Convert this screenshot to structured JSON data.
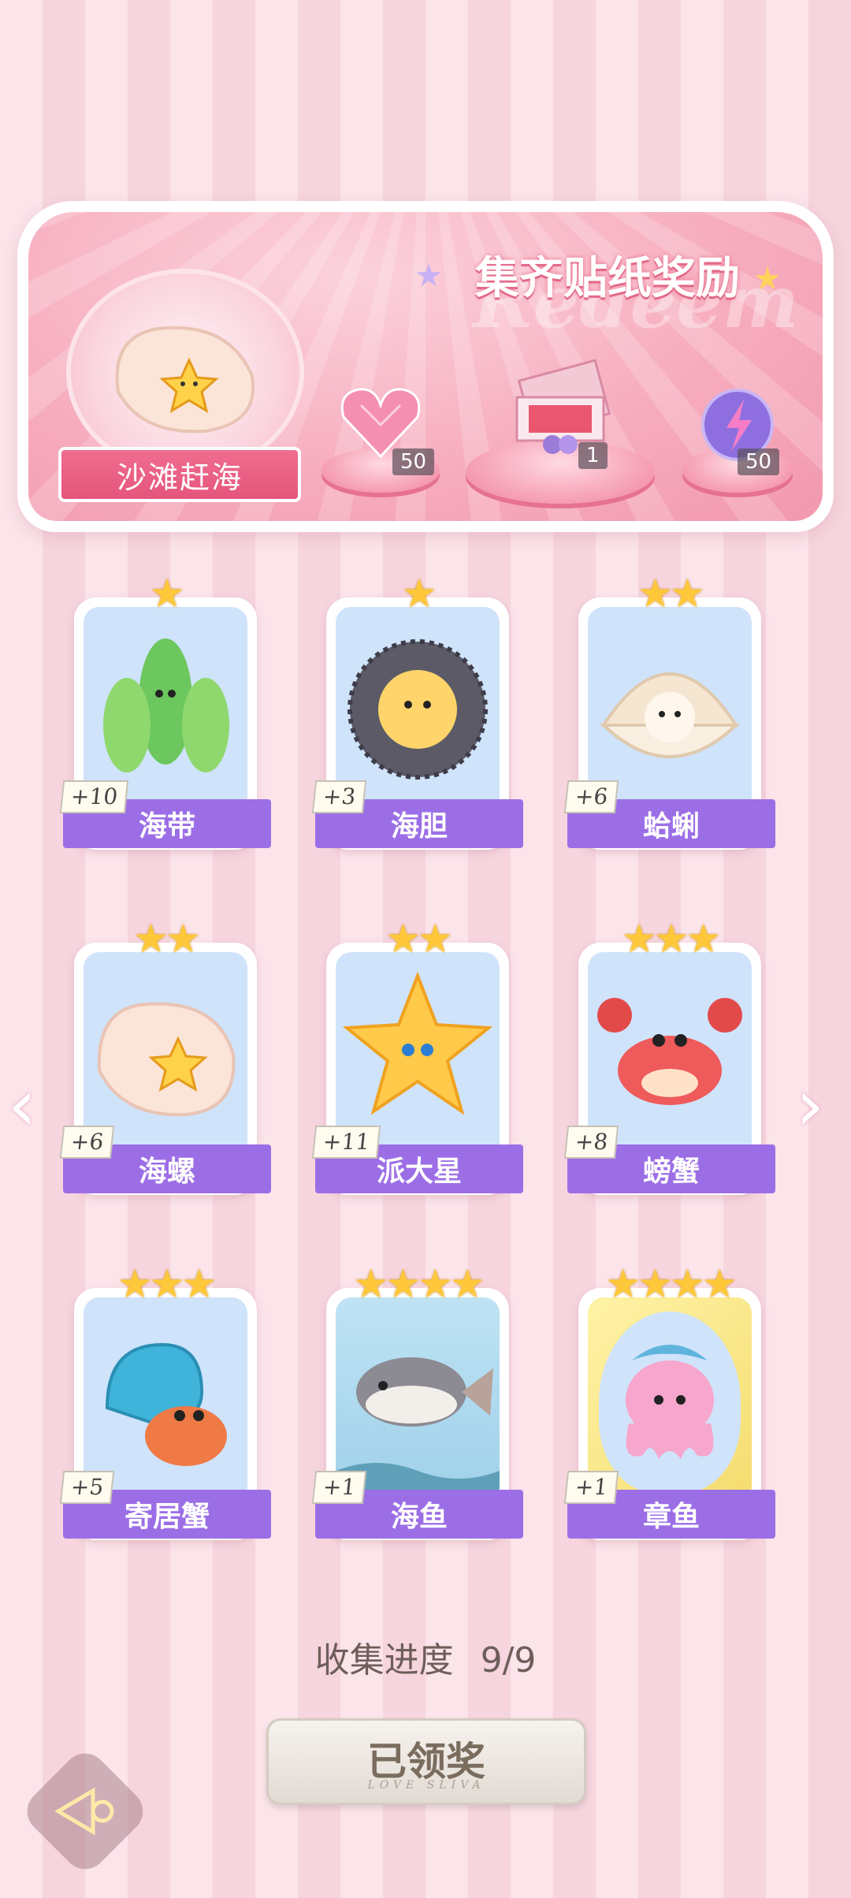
{
  "banner": {
    "title": "集齐贴纸奖励",
    "watermark": "Redeem",
    "set_name": "沙滩赶海",
    "rewards": [
      {
        "icon": "pink-diamond-heart-icon",
        "count": "50"
      },
      {
        "icon": "gift-box-icon",
        "count": "1"
      },
      {
        "icon": "energy-orb-icon",
        "count": "50"
      }
    ]
  },
  "cards": [
    {
      "name": "海带",
      "count": "+10",
      "stars": "★",
      "icon": "kelp-icon"
    },
    {
      "name": "海胆",
      "count": "+3",
      "stars": "★",
      "icon": "sea-urchin-icon"
    },
    {
      "name": "蛤蜊",
      "count": "+6",
      "stars": "★★",
      "icon": "clam-icon"
    },
    {
      "name": "海螺",
      "count": "+6",
      "stars": "★★",
      "icon": "conch-icon"
    },
    {
      "name": "派大星",
      "count": "+11",
      "stars": "★★",
      "icon": "starfish-icon"
    },
    {
      "name": "螃蟹",
      "count": "+8",
      "stars": "★★★",
      "icon": "crab-icon"
    },
    {
      "name": "寄居蟹",
      "count": "+5",
      "stars": "★★★",
      "icon": "hermit-crab-icon"
    },
    {
      "name": "海鱼",
      "count": "+1",
      "stars": "★★★★",
      "icon": "fish-icon"
    },
    {
      "name": "章鱼",
      "count": "+1",
      "stars": "★★★★",
      "icon": "octopus-icon"
    }
  ],
  "nav": {
    "prev": "‹",
    "next": "›"
  },
  "progress": {
    "label": "收集进度",
    "value": "9/9"
  },
  "claim": {
    "label": "已领奖",
    "sub": "LOVE SLIVA"
  },
  "colors": {
    "accent": "#9c6ee6",
    "ribbon": "#e4557b",
    "star": "#ffc83a"
  }
}
